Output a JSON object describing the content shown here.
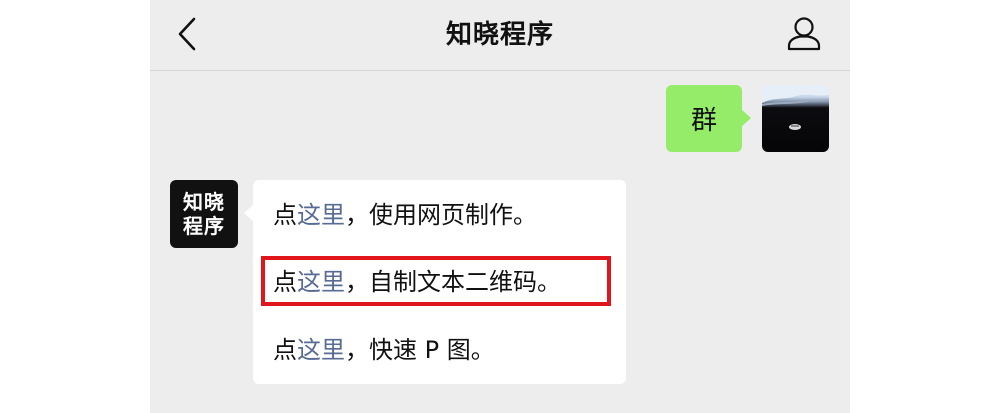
{
  "nav": {
    "title": "知晓程序",
    "back_icon": "chevron-left-icon",
    "profile_icon": "person-icon"
  },
  "messages": {
    "outgoing": {
      "text": "群"
    },
    "incoming": {
      "avatar_line1": "知晓",
      "avatar_line2": "程序",
      "lines": [
        {
          "prefix": "点",
          "link": "这里",
          "suffix": "，使用网页制作。"
        },
        {
          "prefix": "点",
          "link": "这里",
          "suffix": "，自制文本二维码。"
        },
        {
          "prefix": "点",
          "link": "这里",
          "suffix": "，快速 P 图。"
        }
      ]
    }
  },
  "colors": {
    "link": "#576b95",
    "outgoing_bubble": "#95ec69",
    "highlight": "#e0161c",
    "background": "#ededed"
  }
}
